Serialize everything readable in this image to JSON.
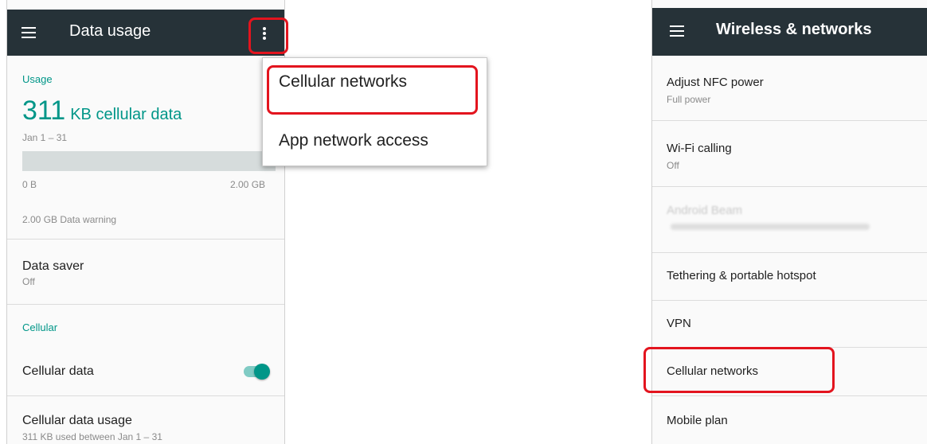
{
  "left": {
    "title": "Data usage",
    "usage_section": "Usage",
    "usage_value": "311",
    "usage_unit": "KB cellular data",
    "date_range": "Jan 1 – 31",
    "bar_min": "0 B",
    "bar_max": "2.00 GB",
    "warning": "2.00 GB Data warning",
    "data_saver_title": "Data saver",
    "data_saver_value": "Off",
    "cellular_section": "Cellular",
    "cellular_data_label": "Cellular data",
    "cellular_data_on": true,
    "cellular_usage_title": "Cellular data usage",
    "cellular_usage_summary": "311 KB used between Jan 1 – 31"
  },
  "popup": {
    "items": [
      "Cellular networks",
      "App network access"
    ]
  },
  "right": {
    "title": "Wireless & networks",
    "items": [
      {
        "title": "Adjust NFC power",
        "subtitle": "Full power"
      },
      {
        "title": "Wi-Fi calling",
        "subtitle": "Off"
      },
      {
        "title": "Android Beam",
        "subtitle": ""
      },
      {
        "title": "Tethering & portable hotspot",
        "subtitle": ""
      },
      {
        "title": "VPN",
        "subtitle": ""
      },
      {
        "title": "Cellular networks",
        "subtitle": ""
      },
      {
        "title": "Mobile plan",
        "subtitle": ""
      }
    ]
  },
  "colors": {
    "appbar": "#263238",
    "accent": "#009688",
    "highlight": "#e3141e"
  }
}
